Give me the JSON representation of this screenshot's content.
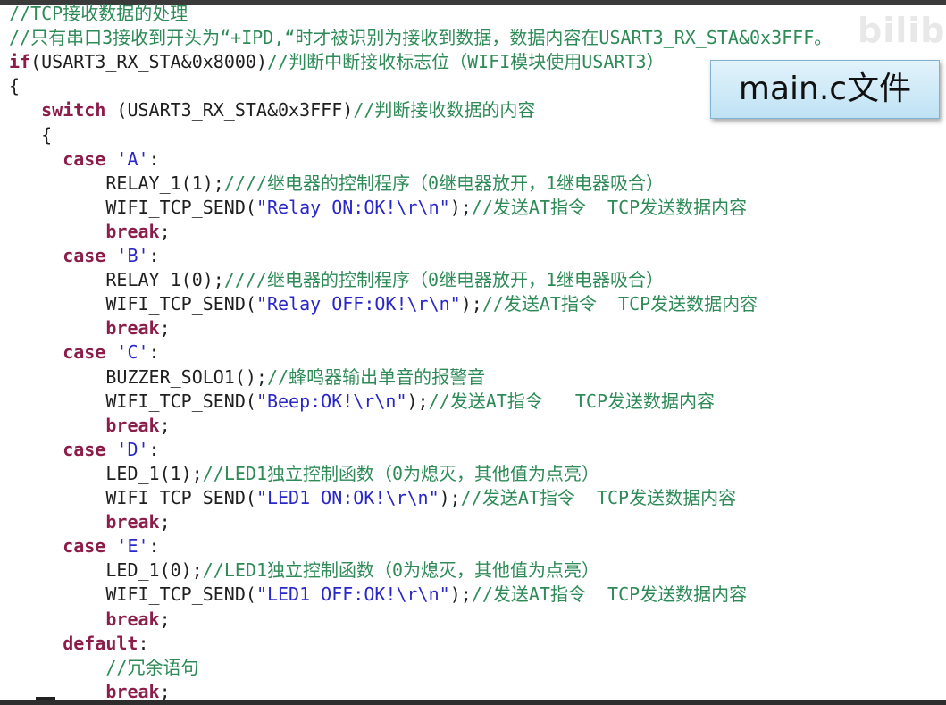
{
  "watermark": "bilib",
  "note_label": "main.c文件",
  "colors": {
    "keyword": "#8b1d4a",
    "string": "#2a27c8",
    "comment": "#2e8b57",
    "text": "#1f1f1f",
    "note_border": "#7fb3cf"
  },
  "code_lines": [
    {
      "indent": 0,
      "tokens": [
        {
          "t": "cm",
          "v": "//TCP接收数据的处理"
        }
      ]
    },
    {
      "indent": 0,
      "tokens": [
        {
          "t": "cm",
          "v": "//只有串口3接收到开头为“+IPD,“时才被识别为接收到数据，数据内容在USART3_RX_STA&0x3FFF。"
        }
      ]
    },
    {
      "indent": 0,
      "tokens": [
        {
          "t": "kw",
          "v": "if"
        },
        {
          "t": "tx",
          "v": "(USART3_RX_STA&0x8000)"
        },
        {
          "t": "cm",
          "v": "//判断中断接收标志位（WIFI模块使用USART3）"
        }
      ]
    },
    {
      "indent": 0,
      "tokens": [
        {
          "t": "tx",
          "v": "{"
        }
      ]
    },
    {
      "indent": 3,
      "tokens": [
        {
          "t": "kw",
          "v": "switch"
        },
        {
          "t": "tx",
          "v": " (USART3_RX_STA&0x3FFF)"
        },
        {
          "t": "cm",
          "v": "//判断接收数据的内容"
        }
      ]
    },
    {
      "indent": 3,
      "tokens": [
        {
          "t": "tx",
          "v": "{"
        }
      ]
    },
    {
      "indent": 5,
      "tokens": [
        {
          "t": "kw",
          "v": "case"
        },
        {
          "t": "tx",
          "v": " "
        },
        {
          "t": "str",
          "v": "'A'"
        },
        {
          "t": "tx",
          "v": ":"
        }
      ]
    },
    {
      "indent": 9,
      "tokens": [
        {
          "t": "tx",
          "v": "RELAY_1(1);"
        },
        {
          "t": "cm",
          "v": "////继电器的控制程序（0继电器放开，1继电器吸合）"
        }
      ]
    },
    {
      "indent": 9,
      "tokens": [
        {
          "t": "tx",
          "v": "WIFI_TCP_SEND("
        },
        {
          "t": "str",
          "v": "\"Relay ON:OK!\\r\\n\""
        },
        {
          "t": "tx",
          "v": ");"
        },
        {
          "t": "cm",
          "v": "//发送AT指令  TCP发送数据内容"
        }
      ]
    },
    {
      "indent": 9,
      "tokens": [
        {
          "t": "kw",
          "v": "break"
        },
        {
          "t": "tx",
          "v": ";"
        }
      ]
    },
    {
      "indent": 5,
      "tokens": [
        {
          "t": "kw",
          "v": "case"
        },
        {
          "t": "tx",
          "v": " "
        },
        {
          "t": "str",
          "v": "'B'"
        },
        {
          "t": "tx",
          "v": ":"
        }
      ]
    },
    {
      "indent": 9,
      "tokens": [
        {
          "t": "tx",
          "v": "RELAY_1(0);"
        },
        {
          "t": "cm",
          "v": "////继电器的控制程序（0继电器放开，1继电器吸合）"
        }
      ]
    },
    {
      "indent": 9,
      "tokens": [
        {
          "t": "tx",
          "v": "WIFI_TCP_SEND("
        },
        {
          "t": "str",
          "v": "\"Relay OFF:OK!\\r\\n\""
        },
        {
          "t": "tx",
          "v": ");"
        },
        {
          "t": "cm",
          "v": "//发送AT指令  TCP发送数据内容"
        }
      ]
    },
    {
      "indent": 9,
      "tokens": [
        {
          "t": "kw",
          "v": "break"
        },
        {
          "t": "tx",
          "v": ";"
        }
      ]
    },
    {
      "indent": 5,
      "tokens": [
        {
          "t": "kw",
          "v": "case"
        },
        {
          "t": "tx",
          "v": " "
        },
        {
          "t": "str",
          "v": "'C'"
        },
        {
          "t": "tx",
          "v": ":"
        }
      ]
    },
    {
      "indent": 9,
      "tokens": [
        {
          "t": "tx",
          "v": "BUZZER_SOLO1();"
        },
        {
          "t": "cm",
          "v": "//蜂鸣器输出单音的报警音"
        }
      ]
    },
    {
      "indent": 9,
      "tokens": [
        {
          "t": "tx",
          "v": "WIFI_TCP_SEND("
        },
        {
          "t": "str",
          "v": "\"Beep:OK!\\r\\n\""
        },
        {
          "t": "tx",
          "v": ");"
        },
        {
          "t": "cm",
          "v": "//发送AT指令   TCP发送数据内容"
        }
      ]
    },
    {
      "indent": 9,
      "tokens": [
        {
          "t": "kw",
          "v": "break"
        },
        {
          "t": "tx",
          "v": ";"
        }
      ]
    },
    {
      "indent": 5,
      "tokens": [
        {
          "t": "kw",
          "v": "case"
        },
        {
          "t": "tx",
          "v": " "
        },
        {
          "t": "str",
          "v": "'D'"
        },
        {
          "t": "tx",
          "v": ":"
        }
      ]
    },
    {
      "indent": 9,
      "tokens": [
        {
          "t": "tx",
          "v": "LED_1(1);"
        },
        {
          "t": "cm",
          "v": "//LED1独立控制函数（0为熄灭，其他值为点亮）"
        }
      ]
    },
    {
      "indent": 9,
      "tokens": [
        {
          "t": "tx",
          "v": "WIFI_TCP_SEND("
        },
        {
          "t": "str",
          "v": "\"LED1 ON:OK!\\r\\n\""
        },
        {
          "t": "tx",
          "v": ");"
        },
        {
          "t": "cm",
          "v": "//发送AT指令  TCP发送数据内容"
        }
      ]
    },
    {
      "indent": 9,
      "tokens": [
        {
          "t": "kw",
          "v": "break"
        },
        {
          "t": "tx",
          "v": ";"
        }
      ]
    },
    {
      "indent": 5,
      "tokens": [
        {
          "t": "kw",
          "v": "case"
        },
        {
          "t": "tx",
          "v": " "
        },
        {
          "t": "str",
          "v": "'E'"
        },
        {
          "t": "tx",
          "v": ":"
        }
      ]
    },
    {
      "indent": 9,
      "tokens": [
        {
          "t": "tx",
          "v": "LED_1(0);"
        },
        {
          "t": "cm",
          "v": "//LED1独立控制函数（0为熄灭，其他值为点亮）"
        }
      ]
    },
    {
      "indent": 9,
      "tokens": [
        {
          "t": "tx",
          "v": "WIFI_TCP_SEND("
        },
        {
          "t": "str",
          "v": "\"LED1 OFF:OK!\\r\\n\""
        },
        {
          "t": "tx",
          "v": ");"
        },
        {
          "t": "cm",
          "v": "//发送AT指令  TCP发送数据内容"
        }
      ]
    },
    {
      "indent": 9,
      "tokens": [
        {
          "t": "kw",
          "v": "break"
        },
        {
          "t": "tx",
          "v": ";"
        }
      ]
    },
    {
      "indent": 5,
      "tokens": [
        {
          "t": "kw",
          "v": "default"
        },
        {
          "t": "tx",
          "v": ":"
        }
      ]
    },
    {
      "indent": 9,
      "tokens": [
        {
          "t": "cm",
          "v": "//冗余语句"
        }
      ]
    },
    {
      "indent": 9,
      "tokens": [
        {
          "t": "kw",
          "v": "break"
        },
        {
          "t": "tx",
          "v": ";"
        }
      ]
    }
  ]
}
